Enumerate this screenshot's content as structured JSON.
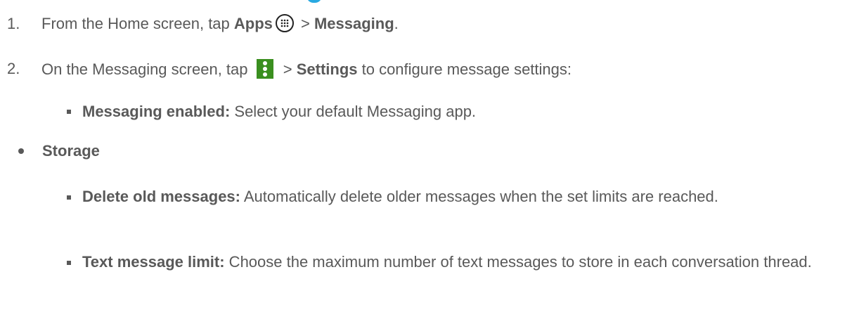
{
  "steps": [
    {
      "number": "1.",
      "prefix": "From the Home screen, tap ",
      "bold1": "Apps",
      "sep": " > ",
      "bold2": "Messaging",
      "suffix": "."
    },
    {
      "number": "2.",
      "prefix": "On the Messaging screen, tap ",
      "sep": " > ",
      "bold": "Settings",
      "suffix": " to configure message settings:"
    }
  ],
  "settings": [
    {
      "label": "Messaging enabled:",
      "desc": " Select your default Messaging app."
    }
  ],
  "section": {
    "label": "Storage"
  },
  "storage_items": [
    {
      "label": "Delete old messages:",
      "desc": " Automatically delete older messages when the set limits are reached."
    },
    {
      "label": "Text message limit:",
      "desc": " Choose the maximum number of text messages to store in each conversation thread."
    }
  ],
  "colors": {
    "text": "#595959",
    "accent_green": "#3a8f1f",
    "heading_blue": "#29a9e1"
  },
  "icons": {
    "apps": "apps-grid-icon",
    "menu": "more-vertical-icon"
  }
}
